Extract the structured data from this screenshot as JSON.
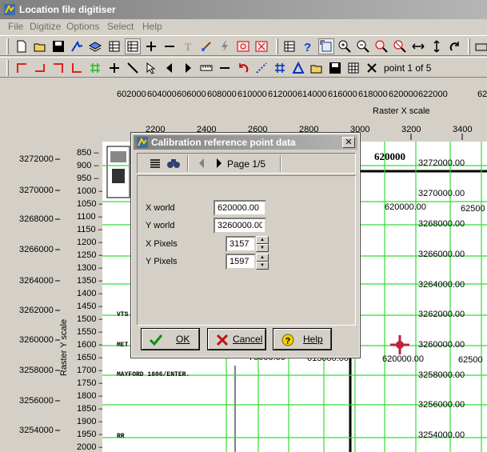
{
  "window": {
    "title": "Location file digitiser"
  },
  "menu": [
    "File",
    "Digitize",
    "Options",
    "Select",
    "Help"
  ],
  "toolbar2": {
    "point_label": "point 1 of 5"
  },
  "raster_x": {
    "top_ticks": [
      "602000",
      "604000",
      "606000",
      "608000",
      "610000",
      "612000",
      "614000",
      "616000",
      "618000",
      "620000",
      "622000",
      "62"
    ],
    "label": "Raster X scale",
    "pixel_ticks": [
      "2200",
      "2400",
      "2600",
      "2800",
      "3000",
      "3200",
      "3400"
    ]
  },
  "raster_y": {
    "label": "Raster Y scale",
    "world_ticks": [
      "3272000",
      "3270000",
      "3268000",
      "3266000",
      "3264000",
      "3262000",
      "3260000",
      "3258000",
      "3256000",
      "3254000"
    ],
    "pixel_ticks": [
      "850",
      "900",
      "950",
      "1000",
      "1050",
      "1100",
      "1150",
      "1200",
      "1250",
      "1300",
      "1350",
      "1400",
      "1450",
      "1500",
      "1550",
      "1600",
      "1650",
      "1700",
      "1750",
      "1800",
      "1850",
      "1900",
      "1950",
      "2000"
    ]
  },
  "map": {
    "header": "620000",
    "right_labels": [
      "3272000.00",
      "3270000.00",
      "3268000.00",
      "3266000.00",
      "3264000.00",
      "3262000.00",
      "3260000.00",
      "3258000.00",
      "3256000.00",
      "3254000.00"
    ],
    "x_grid_labels": [
      "620000.00",
      "62500"
    ],
    "lower_x_labels": [
      "620000.00",
      "62500"
    ],
    "mid_labels": [
      "75000.00",
      "613000.00"
    ],
    "scan_texts": [
      "MAYFORD 1806/ENTER.",
      "VTS",
      "MET",
      "RR"
    ]
  },
  "dialog": {
    "title": "Calibration reference point data",
    "page_label": "Page 1/5",
    "fields": {
      "x_world": {
        "label": "X world",
        "value": "620000.00"
      },
      "y_world": {
        "label": "Y world",
        "value": "3260000.00"
      },
      "x_pixels": {
        "label": "X Pixels",
        "value": "3157"
      },
      "y_pixels": {
        "label": "Y Pixels",
        "value": "1597"
      }
    },
    "buttons": {
      "ok": "OK",
      "cancel": "Cancel",
      "help": "Help"
    }
  },
  "colors": {
    "grid": "#33dd33",
    "marker": "#c0203a",
    "toolbar_red": "#e02020"
  }
}
